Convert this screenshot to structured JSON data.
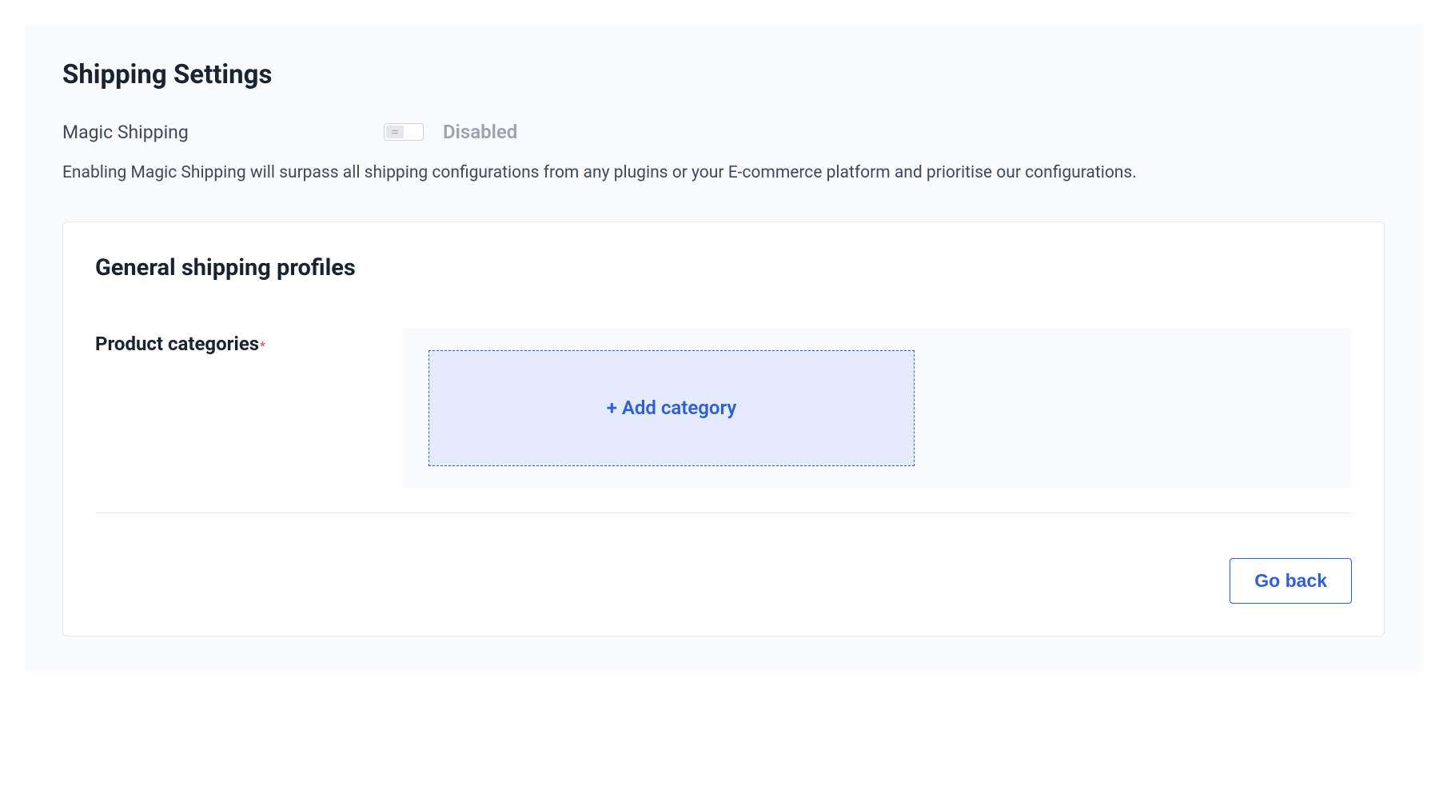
{
  "page": {
    "title": "Shipping Settings",
    "toggle": {
      "label": "Magic Shipping",
      "status": "Disabled"
    },
    "description": "Enabling Magic Shipping will surpass all shipping configurations from any plugins or your E-commerce platform and prioritise our configurations."
  },
  "card": {
    "title": "General shipping profiles",
    "section": {
      "label": "Product categories",
      "required_marker": "*",
      "add_button": "+ Add category"
    }
  },
  "footer": {
    "go_back": "Go back"
  }
}
